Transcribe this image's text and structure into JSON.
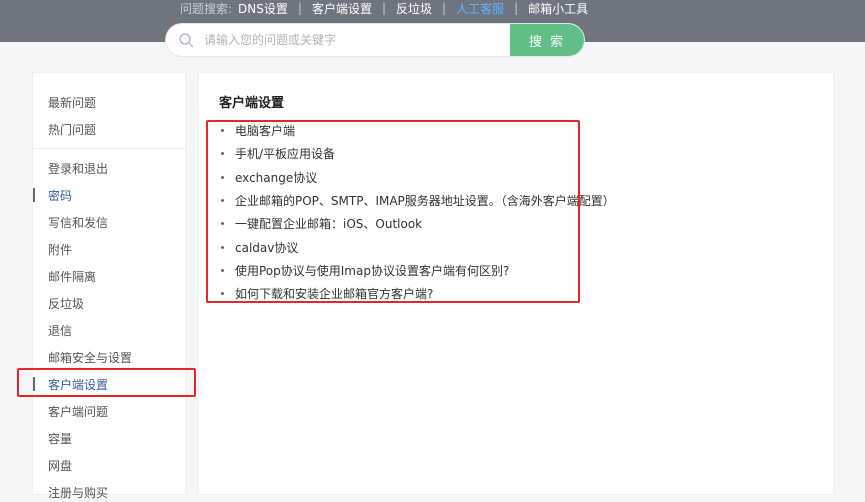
{
  "header": {
    "prefix": "问题搜索:",
    "links": [
      "DNS设置",
      "客户端设置",
      "反垃圾",
      "人工客服",
      "邮箱小工具"
    ],
    "active_link_color": "#59b7ff"
  },
  "search": {
    "placeholder": "请输入您的问题或关键字",
    "button_label": "搜 索",
    "button_color": "#5fbf86"
  },
  "sidebar": {
    "items": [
      "最新问题",
      "热门问题",
      "登录和退出",
      "密码",
      "写信和发信",
      "附件",
      "邮件隔离",
      "反垃圾",
      "退信",
      "邮箱安全与设置",
      "客户端设置",
      "客户端问题",
      "容量",
      "网盘",
      "注册与购买"
    ]
  },
  "content": {
    "title": "客户端设置",
    "items": [
      "电脑客户端",
      "手机/平板应用设备",
      "exchange协议",
      "企业邮箱的POP、SMTP、IMAP服务器地址设置。（含海外客户端配置）",
      "一键配置企业邮箱：iOS、Outlook",
      "caldav协议",
      "使用Pop协议与使用Imap协议设置客户端有何区别?",
      "如何下载和安装企业邮箱官方客户端?"
    ]
  },
  "colors": {
    "header_bg": "#6e7480",
    "highlight": "#e5262b",
    "active_text": "#34609b"
  }
}
